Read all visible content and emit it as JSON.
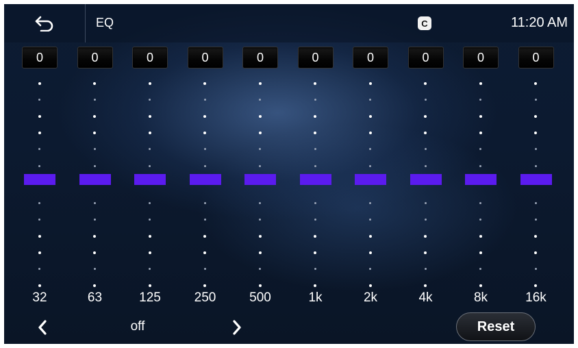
{
  "header": {
    "title": "EQ",
    "back_icon": "back-arrow-icon",
    "app_icon": "carplay-icon",
    "app_icon_glyph": "C",
    "time": "11:20 AM"
  },
  "eq": {
    "bands": [
      {
        "freq": "32",
        "value": "0"
      },
      {
        "freq": "63",
        "value": "0"
      },
      {
        "freq": "125",
        "value": "0"
      },
      {
        "freq": "250",
        "value": "0"
      },
      {
        "freq": "500",
        "value": "0"
      },
      {
        "freq": "1k",
        "value": "0"
      },
      {
        "freq": "2k",
        "value": "0"
      },
      {
        "freq": "4k",
        "value": "0"
      },
      {
        "freq": "8k",
        "value": "0"
      },
      {
        "freq": "16k",
        "value": "0"
      }
    ],
    "thumb_color": "#5b1bef"
  },
  "footer": {
    "preset": "off",
    "prev_icon": "chevron-left-icon",
    "next_icon": "chevron-right-icon",
    "reset_label": "Reset"
  }
}
